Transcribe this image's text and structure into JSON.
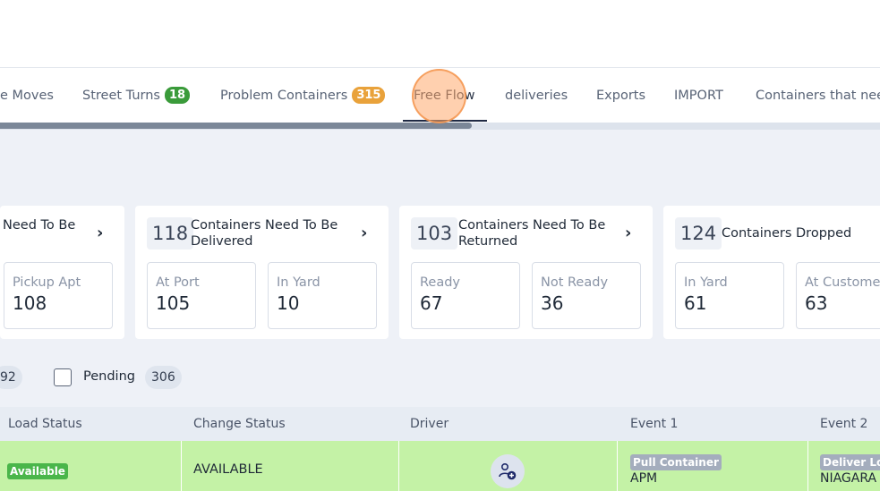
{
  "tabs": [
    {
      "label": "e Moves"
    },
    {
      "label": "Street Turns",
      "badge": "18"
    },
    {
      "label": "Problem Containers",
      "badge": "315"
    },
    {
      "label": "Free Flow"
    },
    {
      "label": "deliveries"
    },
    {
      "label": "Exports"
    },
    {
      "label": "IMPORT"
    },
    {
      "label": "Containers that nee"
    }
  ],
  "colors": {
    "street_turns_badge": "#3a9b3a",
    "problem_badge": "#e9a23b",
    "row_bg": "#c4f2a6"
  },
  "cards": [
    {
      "title": "Need To Be",
      "subs": [
        {
          "label": "Pickup Apt",
          "value": "108"
        }
      ]
    },
    {
      "count": "118",
      "title_line1": "Containers Need To Be",
      "title_line2": "Delivered",
      "subs": [
        {
          "label": "At Port",
          "value": "105"
        },
        {
          "label": "In Yard",
          "value": "10"
        }
      ]
    },
    {
      "count": "103",
      "title_line1": "Containers Need To Be",
      "title_line2": "Returned",
      "subs": [
        {
          "label": "Ready",
          "value": "67"
        },
        {
          "label": "Not Ready",
          "value": "36"
        }
      ]
    },
    {
      "count": "124",
      "title": "Containers Dropped",
      "subs": [
        {
          "label": "In Yard",
          "value": "61"
        },
        {
          "label": "At Customer",
          "value": "63"
        }
      ]
    }
  ],
  "filters": {
    "left_count": "92",
    "pending_label": "Pending",
    "pending_count": "306"
  },
  "table": {
    "headers": [
      "Load Status",
      "Change Status",
      "Driver",
      "Event 1",
      "Event 2"
    ],
    "row": {
      "load_status": "Available",
      "change_status": "AVAILABLE",
      "event1_tag": "Pull Container",
      "event1_loc": "APM",
      "event2_tag": "Deliver Loa",
      "event2_loc": "NIAGARA"
    }
  },
  "icons": {
    "chevron": "chevron-right-icon",
    "driver": "assign-driver-icon"
  }
}
